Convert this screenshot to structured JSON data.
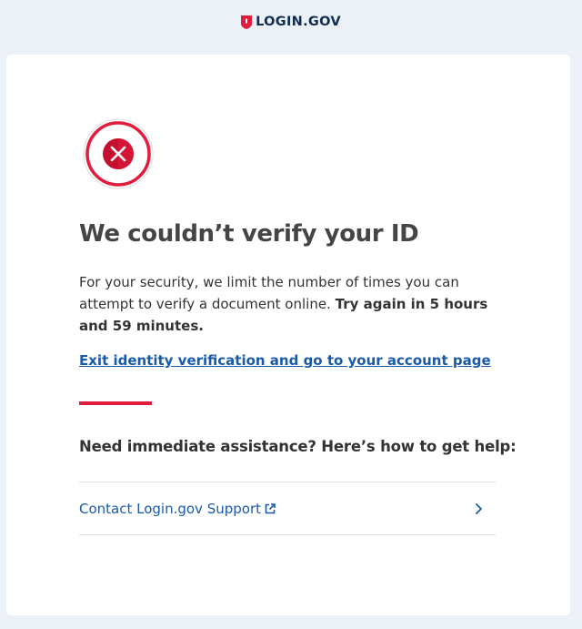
{
  "header": {
    "brand": "LOGIN.GOV",
    "brand_color": "#e21c3d",
    "brand_text_color": "#112e51"
  },
  "status": {
    "icon": "error-x-icon",
    "color": "#e21c3d"
  },
  "main": {
    "title": "We couldn’t verify your ID",
    "message": "For your security, we limit the number of times you can attempt to verify a document online.",
    "message_emphasis": "Try again in 5 hours and 59 minutes.",
    "exit_link": "Exit identity verification and go to your account page"
  },
  "help": {
    "heading": "Need immediate assistance? Here’s how to get help:",
    "items": [
      {
        "label": "Contact Login.gov Support",
        "icon": "external-link-icon",
        "action_icon": "chevron-right-icon"
      }
    ]
  },
  "colors": {
    "link": "#1a5aa8",
    "accent": "#e21c3d",
    "page_background": "#ecf1f8"
  }
}
